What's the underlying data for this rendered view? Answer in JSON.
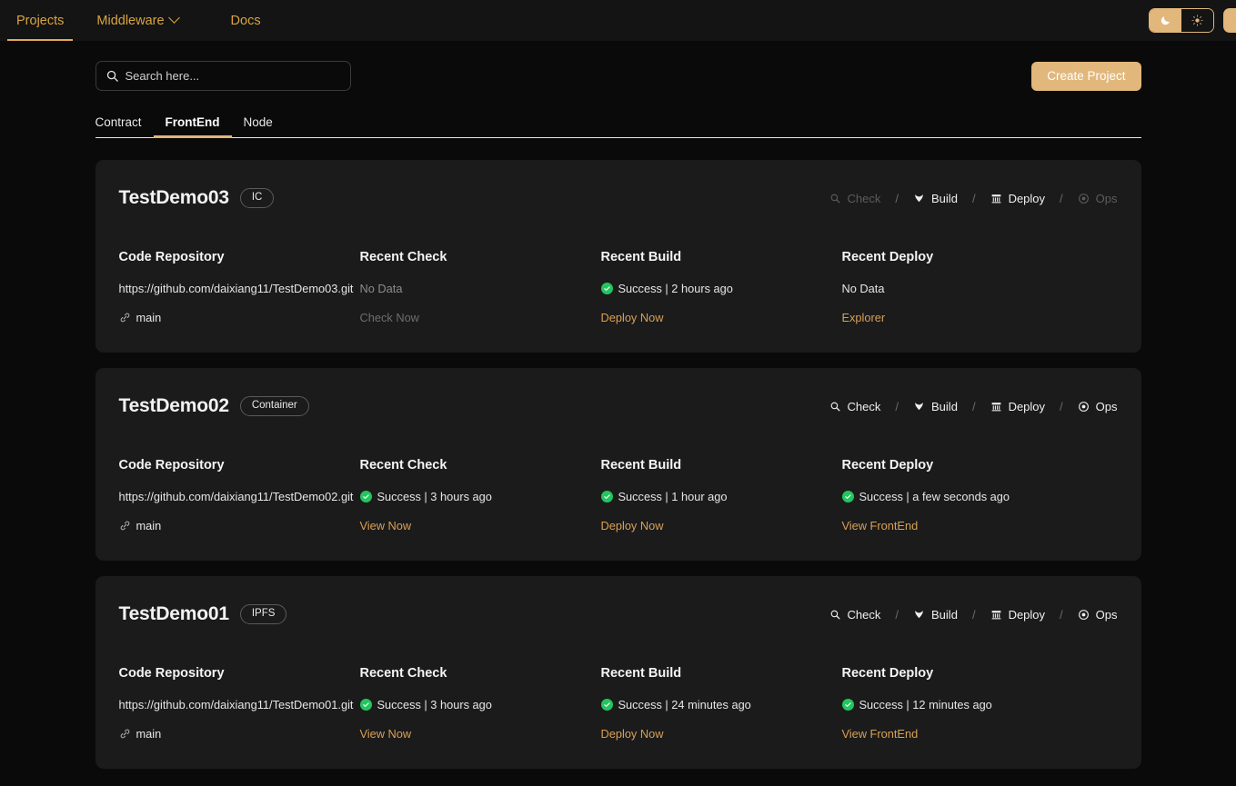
{
  "topnav": {
    "items": [
      {
        "label": "Projects",
        "active": true,
        "caret": false
      },
      {
        "label": "Middleware",
        "active": false,
        "caret": true
      },
      {
        "label": "Docs",
        "active": false,
        "caret": false
      }
    ],
    "theme": {
      "dark_icon": "moon-icon",
      "light_icon": "sun-icon",
      "dark_glyph": "☾",
      "light_glyph": "☀",
      "selected": "dark"
    },
    "accent_color": "#e2b77b"
  },
  "toolbar": {
    "search_placeholder": "Search here...",
    "search_value": "",
    "create_label": "Create Project"
  },
  "tabs": [
    {
      "label": "Contract",
      "active": false
    },
    {
      "label": "FrontEnd",
      "active": true
    },
    {
      "label": "Node",
      "active": false
    }
  ],
  "column_titles": {
    "repo": "Code Repository",
    "check": "Recent Check",
    "build": "Recent Build",
    "deploy": "Recent Deploy"
  },
  "action_labels": {
    "check": "Check",
    "build": "Build",
    "deploy": "Deploy",
    "ops": "Ops",
    "separator": "/"
  },
  "projects": [
    {
      "name": "TestDemo03",
      "badge": "IC",
      "actions": {
        "check_enabled": false,
        "build_enabled": true,
        "deploy_enabled": true,
        "ops_enabled": false
      },
      "repo": {
        "url": "https://github.com/daixiang11/TestDemo03.git",
        "branch": "main"
      },
      "check": {
        "status_text": "No Data",
        "has_status_dot": false,
        "link": "Check Now",
        "link_enabled": false
      },
      "build": {
        "status_text": "Success | 2 hours ago",
        "has_status_dot": true,
        "link": "Deploy Now",
        "link_enabled": true
      },
      "deploy": {
        "status_text": "No Data",
        "has_status_dot": false,
        "link": "Explorer",
        "link_enabled": true
      }
    },
    {
      "name": "TestDemo02",
      "badge": "Container",
      "actions": {
        "check_enabled": true,
        "build_enabled": true,
        "deploy_enabled": true,
        "ops_enabled": true
      },
      "repo": {
        "url": "https://github.com/daixiang11/TestDemo02.git",
        "branch": "main"
      },
      "check": {
        "status_text": "Success | 3 hours ago",
        "has_status_dot": true,
        "link": "View Now",
        "link_enabled": true
      },
      "build": {
        "status_text": "Success | 1 hour ago",
        "has_status_dot": true,
        "link": "Deploy Now",
        "link_enabled": true
      },
      "deploy": {
        "status_text": "Success | a few seconds ago",
        "has_status_dot": true,
        "link": "View FrontEnd",
        "link_enabled": true
      }
    },
    {
      "name": "TestDemo01",
      "badge": "IPFS",
      "actions": {
        "check_enabled": true,
        "build_enabled": true,
        "deploy_enabled": true,
        "ops_enabled": true
      },
      "repo": {
        "url": "https://github.com/daixiang11/TestDemo01.git",
        "branch": "main"
      },
      "check": {
        "status_text": "Success | 3 hours ago",
        "has_status_dot": true,
        "link": "View Now",
        "link_enabled": true
      },
      "build": {
        "status_text": "Success | 24 minutes ago",
        "has_status_dot": true,
        "link": "Deploy Now",
        "link_enabled": true
      },
      "deploy": {
        "status_text": "Success | 12 minutes ago",
        "has_status_dot": true,
        "link": "View FrontEnd",
        "link_enabled": true
      }
    }
  ]
}
